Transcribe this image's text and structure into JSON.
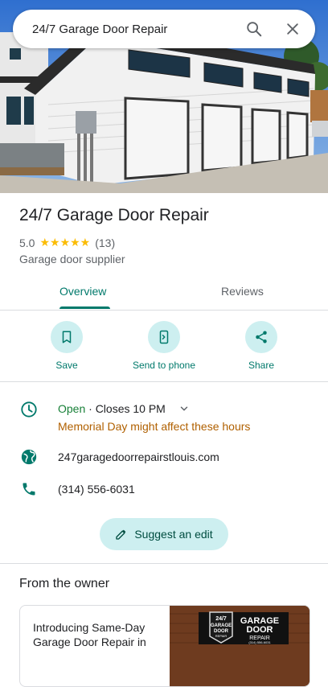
{
  "search": {
    "query": "24/7 Garage Door Repair"
  },
  "business": {
    "name": "24/7 Garage Door Repair",
    "rating": "5.0",
    "stars": "★★★★★",
    "review_count": "(13)",
    "category": "Garage door supplier"
  },
  "tabs": [
    {
      "label": "Overview"
    },
    {
      "label": "Reviews"
    }
  ],
  "actions": [
    {
      "label": "Save"
    },
    {
      "label": "Send to phone"
    },
    {
      "label": "Share"
    }
  ],
  "hours": {
    "status": "Open",
    "detail": " · Closes 10 PM",
    "notice": "Memorial Day might affect these hours"
  },
  "website": "247garagedoorrepairstlouis.com",
  "phone": "(314) 556-6031",
  "suggest_edit": "Suggest an edit",
  "owner": {
    "title": "From the owner",
    "post_text": "Introducing Same-Day Garage Door Repair in",
    "sign": {
      "line1": "24/7",
      "line2": "GARAGE",
      "line3": "DOOR",
      "line4": "REPAIR",
      "phone": "(314) 556-6031",
      "brand_a": "GARAGE",
      "brand_b": "DOOR",
      "brand_c": "REPAIR"
    }
  },
  "colors": {
    "accent": "#00796b",
    "accent_bg": "#cdeff0",
    "open": "#188038",
    "warning": "#b06000",
    "star": "#fbbc04"
  }
}
